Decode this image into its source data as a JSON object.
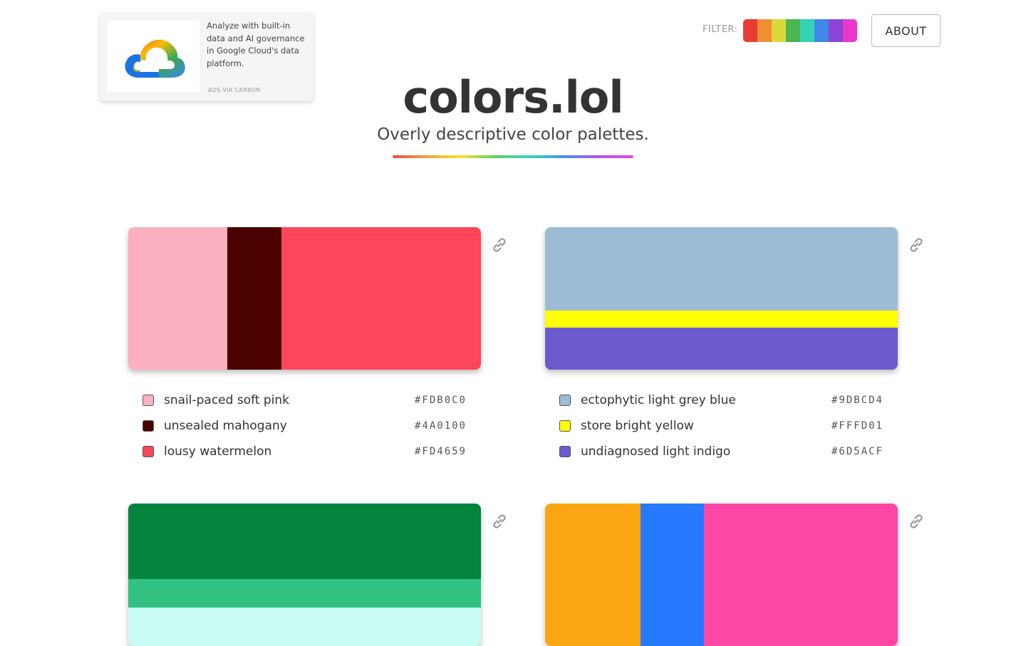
{
  "ad": {
    "text": "Analyze with built-in data and AI governance in Google Cloud's data platform.",
    "via": "ADS VIA CARBON"
  },
  "header": {
    "filter_label": "FILTER:",
    "filter_colors": [
      "#e93c35",
      "#ef8f34",
      "#dbd83a",
      "#4ab552",
      "#34d3b5",
      "#3f87ea",
      "#8a45d8",
      "#ea38cc"
    ],
    "about_label": "ABOUT"
  },
  "site": {
    "title": "colors.lol",
    "subtitle": "Overly descriptive color palettes."
  },
  "palettes": [
    {
      "layout": "columns",
      "colors": [
        {
          "name": "snail-paced soft pink",
          "hex": "#FDB0C0",
          "weight": 28
        },
        {
          "name": "unsealed mahogany",
          "hex": "#4A0100",
          "weight": 15.5
        },
        {
          "name": "lousy watermelon",
          "hex": "#FD4659",
          "weight": 56.5
        }
      ]
    },
    {
      "layout": "rows",
      "colors": [
        {
          "name": "ectophytic light grey blue",
          "hex": "#9DBCD4",
          "weight": 58.5
        },
        {
          "name": "store bright yellow",
          "hex": "#FFFD01",
          "weight": 12
        },
        {
          "name": "undiagnosed light indigo",
          "hex": "#6D5ACF",
          "weight": 29.5
        }
      ]
    },
    {
      "layout": "rows",
      "colors": [
        {
          "name": "",
          "hex": "#05843F",
          "weight": 53
        },
        {
          "name": "",
          "hex": "#31C183",
          "weight": 20
        },
        {
          "name": "",
          "hex": "#C8FCF5",
          "weight": 27
        }
      ]
    },
    {
      "layout": "columns",
      "colors": [
        {
          "name": "",
          "hex": "#FBA512",
          "weight": 27
        },
        {
          "name": "",
          "hex": "#2679FD",
          "weight": 18
        },
        {
          "name": "",
          "hex": "#FE46A5",
          "weight": 55
        }
      ]
    }
  ]
}
